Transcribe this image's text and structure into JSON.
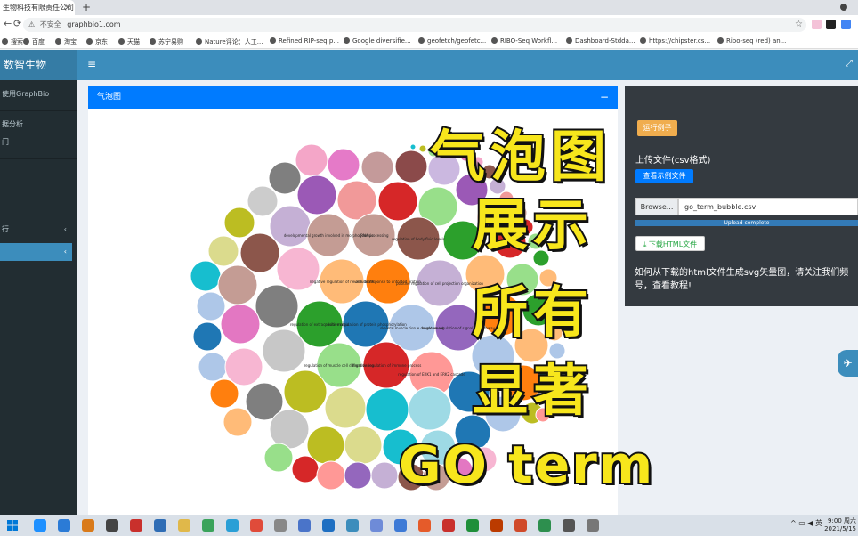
{
  "browser": {
    "tab_title": "生物科技有限责任公司",
    "security": "不安全",
    "url": "graphbio1.com",
    "bookmarks": [
      "搜索",
      "百度",
      "淘宝",
      "京东",
      "天猫",
      "苏宁易购",
      "Nature评论：人工...",
      "Refined RIP-seq p...",
      "Google diversifie...",
      "geofetch/geofetc...",
      "RIBO-Seq Workfl...",
      "Dashboard-Stdda...",
      "https://chipster.cs...",
      "Ribo-seq (red) an..."
    ]
  },
  "app": {
    "logo": "数智生物",
    "sidebar": [
      {
        "label": "使用GraphBio",
        "active": false
      },
      {
        "label": "据分析",
        "active": false
      },
      {
        "label": "门",
        "active": false
      },
      {
        "label": "行",
        "active": false,
        "chevron": "‹"
      },
      {
        "label": "",
        "active": true,
        "chevron": "‹"
      }
    ],
    "bubble_panel": {
      "title": "气泡图",
      "collapse": "−"
    },
    "control": {
      "run_example": "运行例子",
      "upload_label": "上传文件(csv格式)",
      "view_example": "查看示例文件",
      "browse": "Browse...",
      "file_name": "go_term_bubble.csv",
      "upload_status": "Upload complete",
      "download": "下载HTML文件",
      "hint": "如何从下载的html文件生成svg矢量图，请关注我们频号，查看教程!"
    }
  },
  "overlay": {
    "line1": "气泡图",
    "line2": "展示",
    "line3": "所有",
    "line4": "显著",
    "line5": "GO term"
  },
  "bubble_labels": [
    "developmental growth involved in morphogenesis",
    "rRNA processing",
    "regulation of body fluid levels",
    "negative regulation of neuron death",
    "cellular response to unfolded protein",
    "positive regulation of cell projection organization",
    "regulation of extracellular matrix",
    "positive regulation of protein phosphorylation",
    "skeletal muscle tissue development",
    "negative regulation of signaling pathway",
    "regulation of muscle cell differentiation",
    "negative regulation of immune process",
    "regulation of ERK1 and ERK2 cascade"
  ],
  "taskbar": {
    "time": "9:00 周六",
    "date": "2021/5/15",
    "ime": "英"
  }
}
